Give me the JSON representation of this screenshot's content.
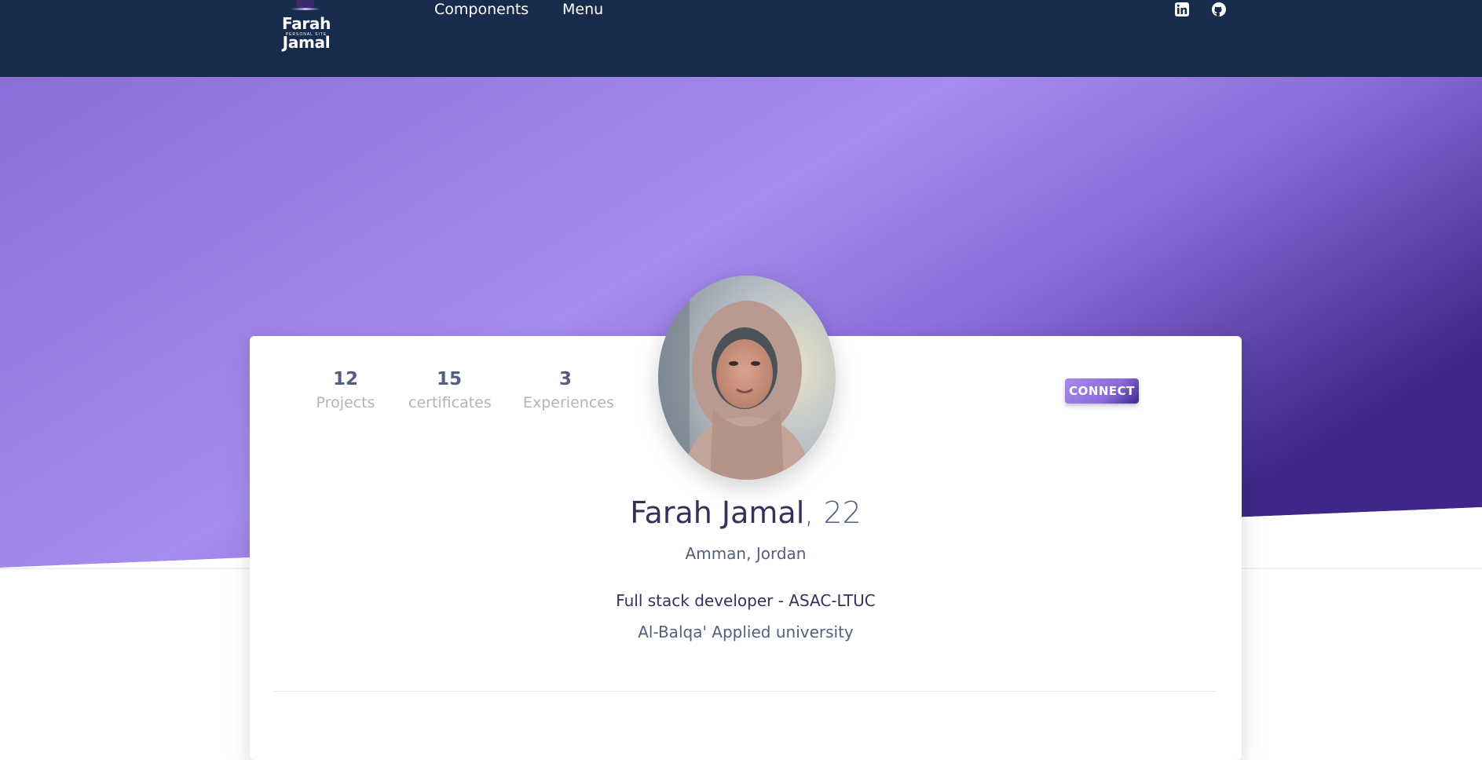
{
  "brand": {
    "name": "Farah Jamal",
    "tagline": "PERSONAL SITE"
  },
  "nav": {
    "links": [
      {
        "label": "Components"
      },
      {
        "label": "Menu"
      }
    ],
    "icons": [
      "linkedin-icon",
      "github-icon"
    ]
  },
  "profile": {
    "stats": [
      {
        "value": "12",
        "label": "Projects"
      },
      {
        "value": "15",
        "label": "certificates"
      },
      {
        "value": "3",
        "label": "Experiences"
      }
    ],
    "connect_label": "CONNECT",
    "name": "Farah Jamal",
    "age": ", 22",
    "location": "Amman, Jordan",
    "job": "Full stack developer - ASAC-LTUC",
    "education": "Al-Balqa' Applied university"
  },
  "colors": {
    "navbar": "#172b4d",
    "hero_start": "#8e6bd8",
    "hero_mid": "#a88fee",
    "hero_end": "#3f2889",
    "accent": "#8b6bdc"
  }
}
